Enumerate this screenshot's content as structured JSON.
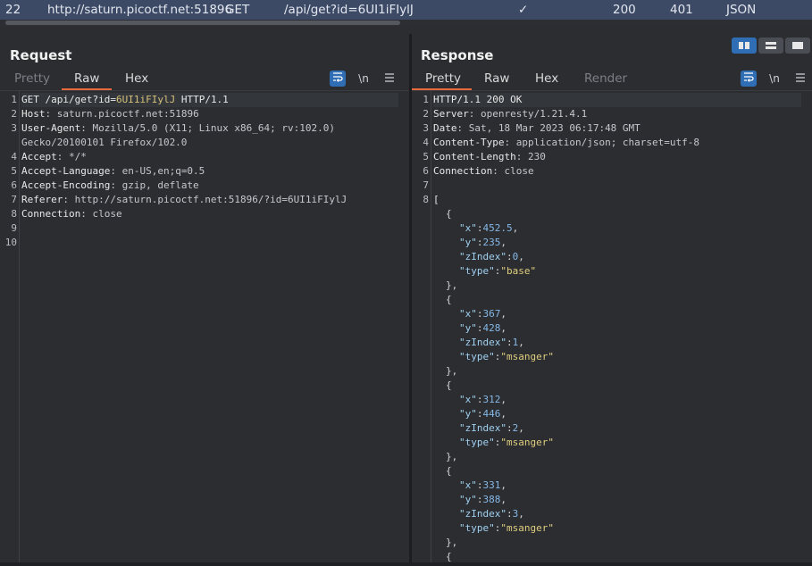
{
  "history_row": {
    "id": "22",
    "host": "http://saturn.picoctf.net:51896",
    "method": "GET",
    "url": "/api/get?id=6UI1iFIylJ",
    "checked": "✓",
    "status": "200",
    "length": "401",
    "mime": "JSON"
  },
  "request": {
    "title": "Request",
    "tabs": [
      "Pretty",
      "Raw",
      "Hex"
    ],
    "active_tab": "Raw",
    "newline_label": "\\n",
    "lines": [
      {
        "n": "1",
        "method": "GET",
        "path": " /api/get?id=",
        "id": "6UI1iFIylJ",
        "proto": " HTTP/1.1"
      },
      {
        "n": "2",
        "key": "Host",
        "val": ": saturn.picoctf.net:51896"
      },
      {
        "n": "3",
        "key": "User-Agent",
        "val": ": Mozilla/5.0 (X11; Linux x86_64; rv:102.0)"
      },
      {
        "n": "",
        "cont": "Gecko/20100101 Firefox/102.0"
      },
      {
        "n": "4",
        "key": "Accept",
        "val": ": */*"
      },
      {
        "n": "5",
        "key": "Accept-Language",
        "val": ": en-US,en;q=0.5"
      },
      {
        "n": "6",
        "key": "Accept-Encoding",
        "val": ": gzip, deflate"
      },
      {
        "n": "7",
        "key": "Referer",
        "val": ": http://saturn.picoctf.net:51896/?id=6UI1iFIylJ"
      },
      {
        "n": "8",
        "key": "Connection",
        "val": ": close"
      },
      {
        "n": "9"
      },
      {
        "n": "10"
      }
    ]
  },
  "response": {
    "title": "Response",
    "tabs": [
      "Pretty",
      "Raw",
      "Hex",
      "Render"
    ],
    "active_tab": "Pretty",
    "newline_label": "\\n",
    "header_lines": [
      {
        "n": "1",
        "status": "HTTP/1.1 200 OK"
      },
      {
        "n": "2",
        "key": "Server",
        "val": ": openresty/1.21.4.1"
      },
      {
        "n": "3",
        "key": "Date",
        "val": ": Sat, 18 Mar 2023 06:17:48 GMT"
      },
      {
        "n": "4",
        "key": "Content-Type",
        "val": ": application/json; charset=utf-8"
      },
      {
        "n": "5",
        "key": "Content-Length",
        "val": ": 230"
      },
      {
        "n": "6",
        "key": "Connection",
        "val": ": close"
      },
      {
        "n": "7"
      },
      {
        "n": "8",
        "open": "["
      }
    ],
    "json_items": [
      {
        "x": "452.5",
        "y": "235",
        "zIndex": "0",
        "type": "\"base\""
      },
      {
        "x": "367",
        "y": "428",
        "zIndex": "1",
        "type": "\"msanger\""
      },
      {
        "x": "312",
        "y": "446",
        "zIndex": "2",
        "type": "\"msanger\""
      },
      {
        "x": "331",
        "y": "388",
        "zIndex": "3",
        "type": "\"msanger\""
      }
    ]
  }
}
